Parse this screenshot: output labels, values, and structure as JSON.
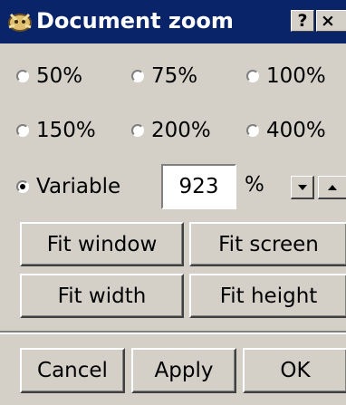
{
  "window": {
    "title": "Document zoom",
    "help_label": "?",
    "close_label": "×",
    "icon": "app-icon"
  },
  "zoom_presets": [
    {
      "label": "50%",
      "checked": false
    },
    {
      "label": "75%",
      "checked": false
    },
    {
      "label": "100%",
      "checked": false
    },
    {
      "label": "150%",
      "checked": false
    },
    {
      "label": "200%",
      "checked": false
    },
    {
      "label": "400%",
      "checked": false
    }
  ],
  "variable": {
    "label": "Variable",
    "checked": true,
    "value": "923",
    "unit": "%"
  },
  "fit_buttons": {
    "fit_window": "Fit window",
    "fit_screen": "Fit screen",
    "fit_width": "Fit width",
    "fit_height": "Fit height"
  },
  "actions": {
    "cancel": "Cancel",
    "apply": "Apply",
    "ok": "OK"
  },
  "colors": {
    "titlebar": "#0a246a",
    "face": "#d4d0c8"
  }
}
